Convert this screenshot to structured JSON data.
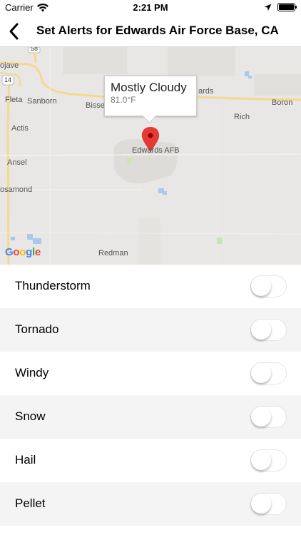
{
  "status_bar": {
    "carrier": "Carrier",
    "time": "2:21 PM",
    "wifi_icon": "wifi-icon",
    "location_icon": "location-arrow-icon",
    "battery_icon": "battery-icon"
  },
  "nav": {
    "back_icon": "chevron-left-icon",
    "title": "Set Alerts for Edwards Air Force Base, CA"
  },
  "map": {
    "callout": {
      "title": "Mostly Cloudy",
      "temperature": "81.0°F"
    },
    "pin_icon": "map-pin-icon",
    "labels": {
      "mojave": "ojave",
      "highway_58": "58",
      "highway_14": "14",
      "sanborn": "Sanborn",
      "bisse": "Bisse",
      "edwards": "ards",
      "boron": "Boron",
      "fleta": "Fleta",
      "rich": "Rich",
      "actis": "Actis",
      "edwards_afb": "Edwards AFB",
      "ansel": "Ansel",
      "rosamond": "osamond",
      "redman": "Redman"
    },
    "attribution": "Google",
    "colors": {
      "land": "#e8e7e5",
      "road": "#f5d88e",
      "water": "#a8c8f0",
      "park": "#c8e6b0",
      "pin": "#e53935"
    }
  },
  "alerts": [
    {
      "label": "Thunderstorm",
      "enabled": false
    },
    {
      "label": "Tornado",
      "enabled": false
    },
    {
      "label": "Windy",
      "enabled": false
    },
    {
      "label": "Snow",
      "enabled": false
    },
    {
      "label": "Hail",
      "enabled": false
    },
    {
      "label": "Pellet",
      "enabled": false
    }
  ]
}
